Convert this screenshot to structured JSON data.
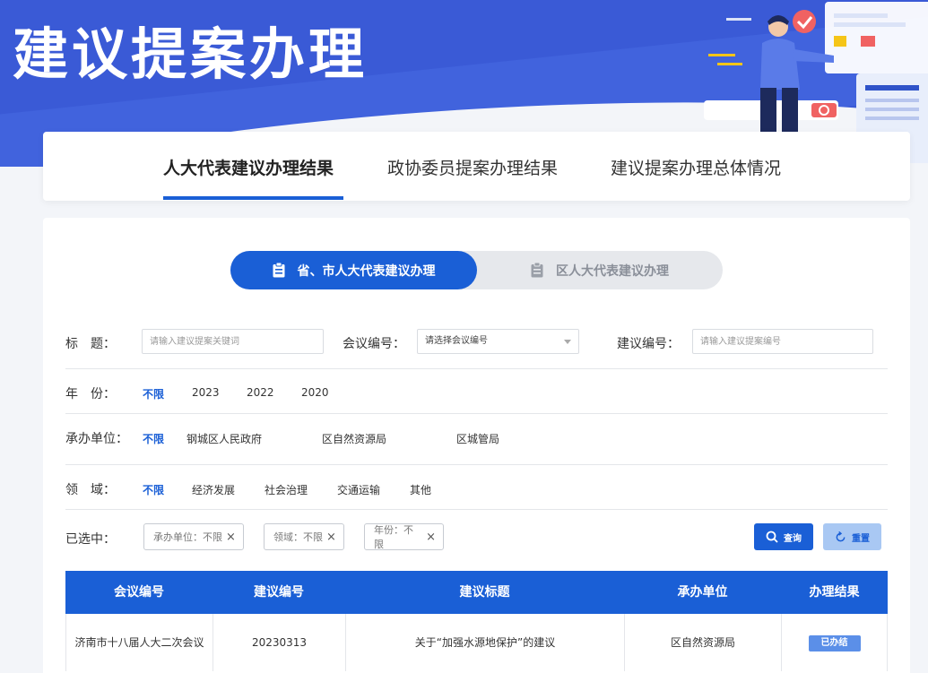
{
  "banner": {
    "title": "建议提案办理"
  },
  "tabs": [
    {
      "label": "人大代表建议办理结果",
      "active": true
    },
    {
      "label": "政协委员提案办理结果",
      "active": false
    },
    {
      "label": "建议提案办理总体情况",
      "active": false
    }
  ],
  "switcher": {
    "active_label": "省、市人大代表建议办理",
    "inactive_label": "区人大代表建议办理"
  },
  "filters": {
    "title_label": "标　题：",
    "title_placeholder": "请输入建议提案关键词",
    "meeting_label": "会议编号：",
    "meeting_placeholder": "请选择会议编号",
    "proposal_label": "建议编号：",
    "proposal_placeholder": "请输入建议提案编号",
    "year_label": "年　份：",
    "year_options": [
      "不限",
      "2023",
      "2022",
      "2020"
    ],
    "unit_label": "承办单位：",
    "unit_options": [
      "不限",
      "钢城区人民政府",
      "区自然资源局",
      "区城管局"
    ],
    "field_label": "领　域：",
    "field_options": [
      "不限",
      "经济发展",
      "社会治理",
      "交通运输",
      "其他"
    ],
    "selected_label": "已选中：",
    "chips": [
      "承办单位：不限",
      "领域：不限",
      "年份：不限"
    ],
    "query_label": "查询",
    "reset_label": "重置"
  },
  "table": {
    "headers": [
      "会议编号",
      "建议编号",
      "建议标题",
      "承办单位",
      "办理结果"
    ],
    "rows": [
      [
        "济南市十八届人大二次会议",
        "20230313",
        "关于“加强水源地保护”的建议",
        "区自然资源局",
        "已办结"
      ]
    ]
  },
  "colors": {
    "primary": "#1a5fd6",
    "banner": "#3a5ad6"
  }
}
